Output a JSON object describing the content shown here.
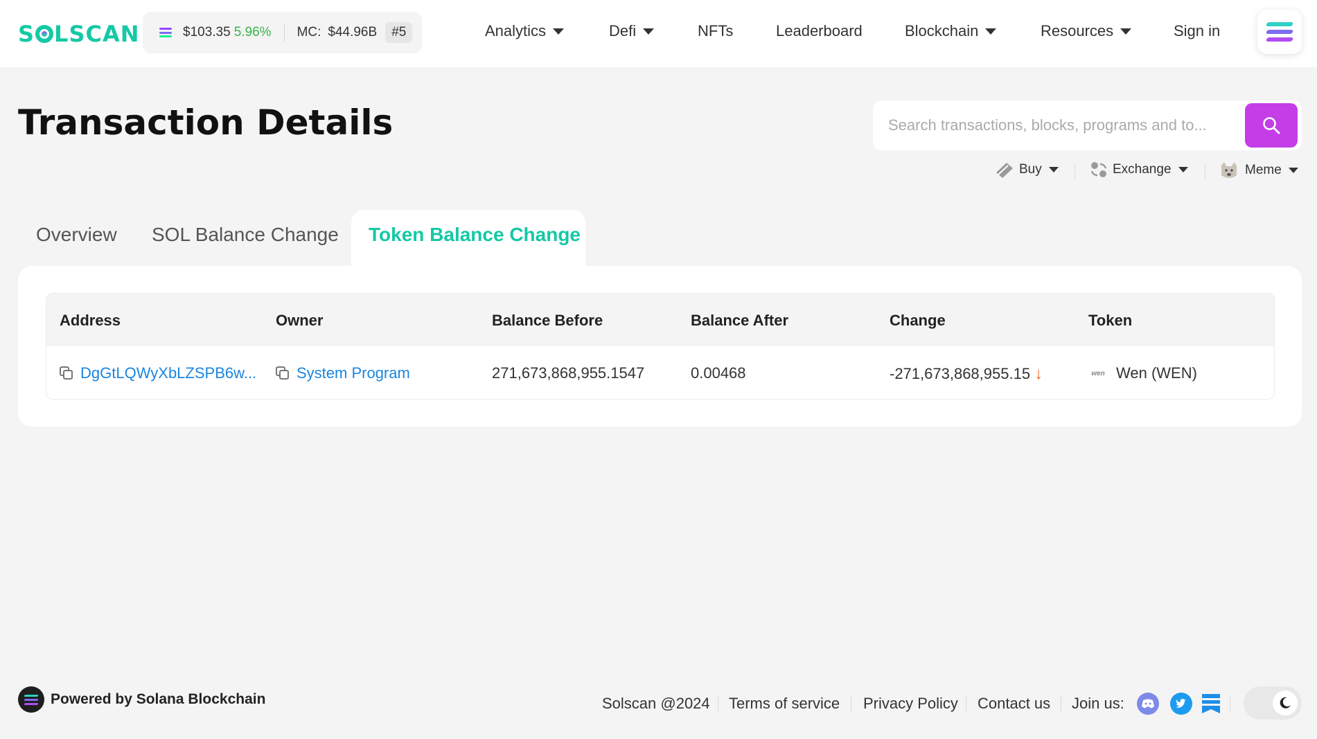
{
  "header": {
    "logo_text_1": "S",
    "logo_text_2": "LSCAN",
    "sol_price": "$103.35",
    "sol_change": "5.96%",
    "mc_label": "MC:",
    "mc_value": "$44.96B",
    "rank": "#5",
    "nav": [
      "Analytics",
      "Defi",
      "NFTs",
      "Leaderboard",
      "Blockchain",
      "Resources",
      "Sign in"
    ]
  },
  "page": {
    "title": "Transaction Details",
    "search_placeholder": "Search transactions, blocks, programs and to..."
  },
  "quick_links": {
    "buy": "Buy",
    "exchange": "Exchange",
    "meme": "Meme"
  },
  "tabs": [
    "Overview",
    "SOL Balance Change",
    "Token Balance Change"
  ],
  "active_tab": "Token Balance Change",
  "table": {
    "headers": [
      "Address",
      "Owner",
      "Balance Before",
      "Balance After",
      "Change",
      "Token"
    ],
    "rows": [
      {
        "address": "DgGtLQWyXbLZSPB6w...",
        "owner": "System Program",
        "balance_before": "271,673,868,955.1547",
        "balance_after": "0.00468",
        "change": "-271,673,868,955.15",
        "token_logo": "wen",
        "token": "Wen (WEN)"
      }
    ]
  },
  "footer": {
    "brand": "Powered by Solana Blockchain",
    "copyright": "Solscan @2024",
    "terms": "Terms of service",
    "privacy": "Privacy Policy",
    "contact": "Contact us",
    "join": "Join us:"
  },
  "colors": {
    "brand_green": "#14c9a5",
    "search_purple": "#c43de6",
    "link_blue": "#1a86e0",
    "positive_green": "#38b449",
    "negative_orange": "#f06a1c"
  }
}
